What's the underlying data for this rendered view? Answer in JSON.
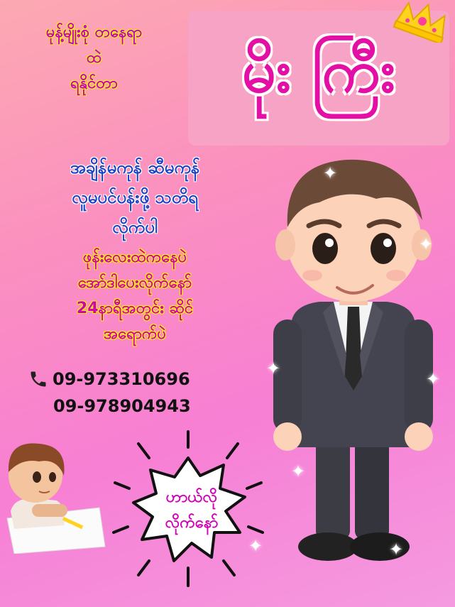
{
  "tagline": {
    "line1": "မုန့်မျိုးစုံ တနေရာ",
    "line2": "ထဲ",
    "line3": "ရနိုင်တာ"
  },
  "brand": {
    "name": "မိုး ကြီး"
  },
  "service": {
    "line1": "အချိန်မကုန် ဆီမကုန်",
    "line2": "လူမပင်ပန်းဖို့ သတိရ",
    "line3": "လိုက်ပါ"
  },
  "order": {
    "line1": "ဖုန်းလေးထဲကနေပဲ",
    "line2": "အော်ဒါပေးလိုက်နော်",
    "line3": "24နာရီအတွင်း ဆိုင်",
    "line4": "အရောက်ပဲ"
  },
  "contact": {
    "phone1": "09-973310696",
    "phone2": "09-978904943",
    "icon": "phone-icon"
  },
  "callout": {
    "line1": "ဟာယ်လို",
    "line2": "လိုက်နော်"
  },
  "colors": {
    "brand_pink": "#e40fa4",
    "magenta_text": "#d400b8",
    "blue_text": "#1a40c8",
    "panel_pink": "#f7a3c5",
    "highlight_yellow": "#fff200"
  }
}
